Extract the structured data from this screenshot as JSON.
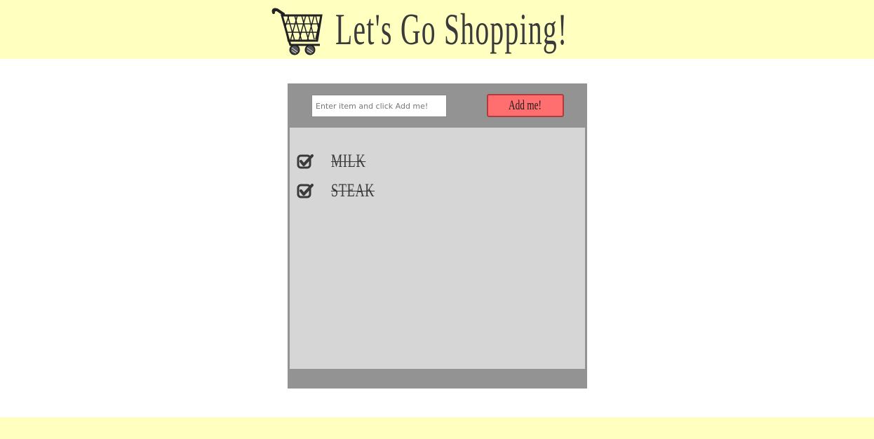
{
  "header": {
    "title": "Let's Go Shopping!",
    "icon": "shopping-cart-icon"
  },
  "form": {
    "input_placeholder": "Enter item and click Add me!",
    "input_value": "",
    "add_label": "Add me!"
  },
  "list": {
    "items": [
      {
        "label": "milk",
        "checked": true
      },
      {
        "label": "steak",
        "checked": true
      }
    ]
  },
  "colors": {
    "header_bg": "#ffffc0",
    "panel_bg": "#939393",
    "list_bg": "#d6d6d6",
    "button_bg": "#ff6f6f",
    "text": "#3a3a3a"
  }
}
